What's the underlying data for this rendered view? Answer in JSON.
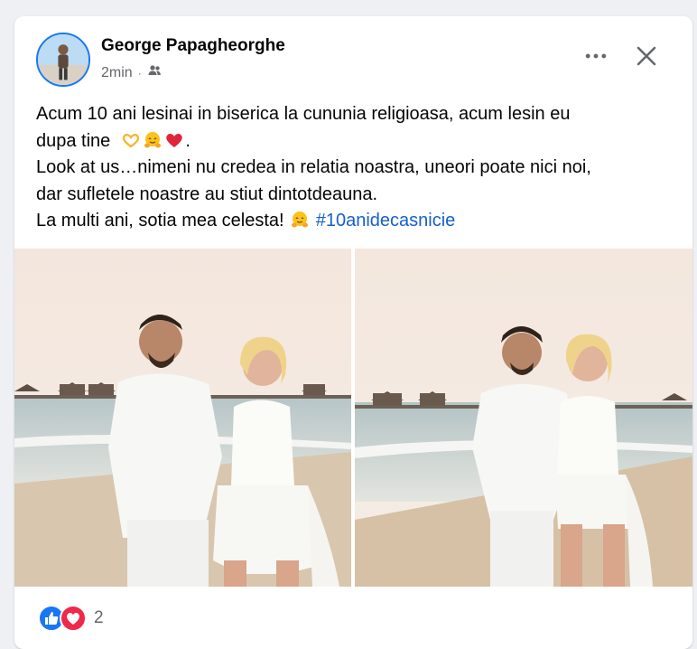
{
  "post": {
    "author": "George Papagheorghe",
    "time": "2min",
    "audience_icon": "friends-icon",
    "text_lines": [
      "Acum 10 ani lesinai in biserica la cununia religioasa, acum lesin eu",
      "dupa tine",
      "Look at us…nimeni nu credea in relatia noastra, uneori poate nici noi,",
      "dar sufletele noastre au stiut dintotdeauna.",
      "La multi ani, sotia mea celesta!"
    ],
    "hashtag": "#10anidecasnicie",
    "emojis_line2": [
      "heart-hands-emoji",
      "hugging-face-emoji",
      "red-heart-emoji"
    ],
    "emoji_line5": "hugging-face-emoji",
    "photos": [
      "couple-beach-photo-1",
      "couple-beach-photo-2"
    ],
    "reactions": {
      "icons": [
        "like-icon",
        "love-icon"
      ],
      "count": "2"
    }
  },
  "colors": {
    "accent": "#1877f2",
    "hashtag": "#1660c8",
    "love": "#f0284a",
    "secondary_text": "#65676b"
  }
}
